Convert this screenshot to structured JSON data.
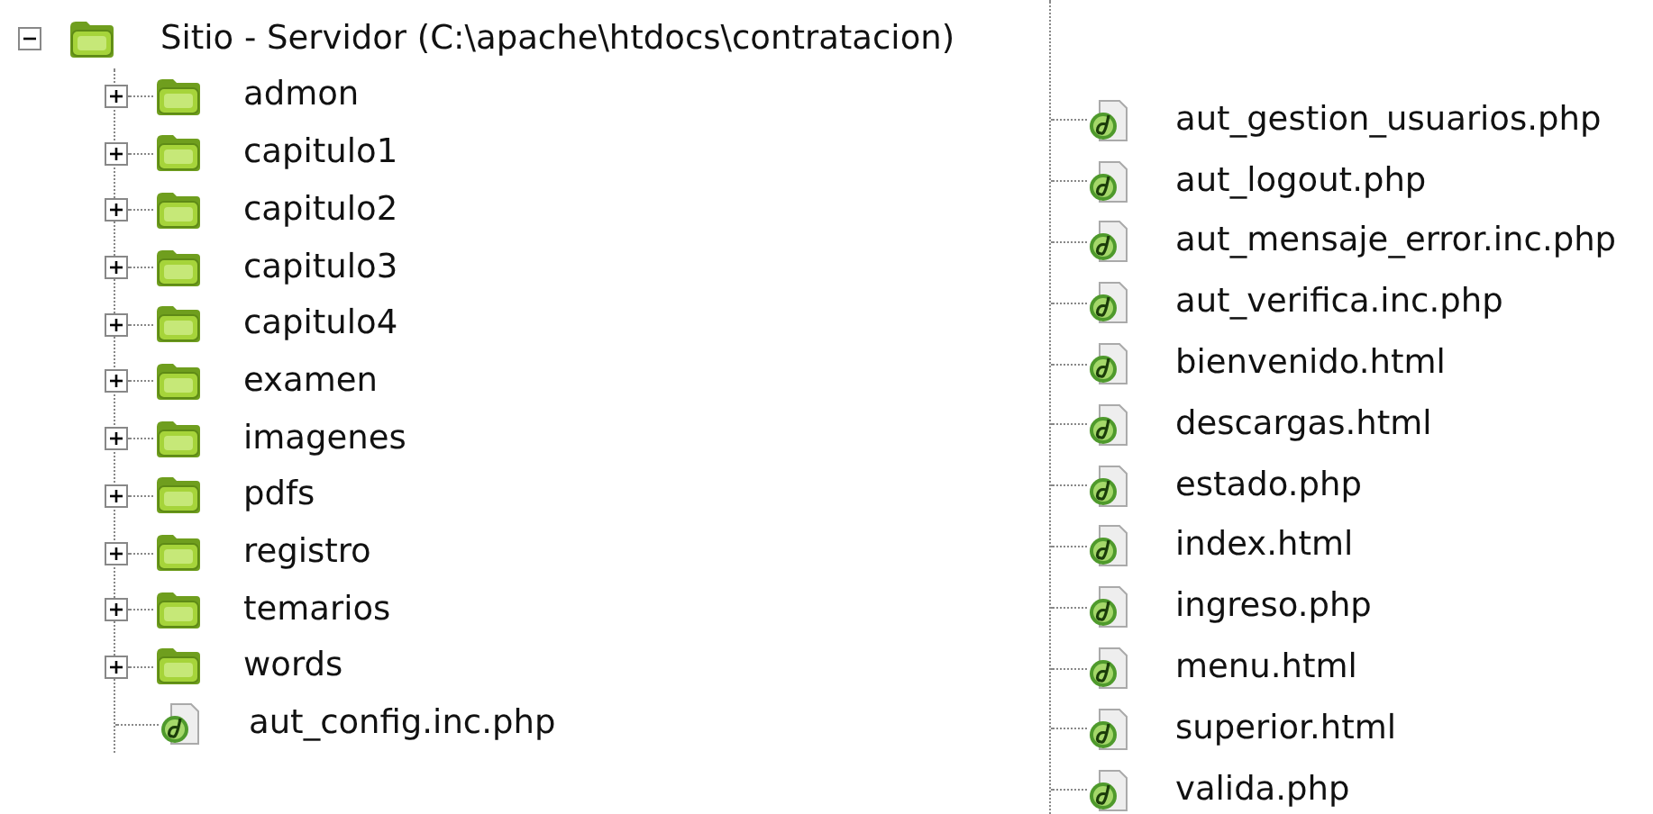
{
  "tree": {
    "label": "Sitio - Servidor (C:\\apache\\htdocs\\contratacion)",
    "expanded": true,
    "children": [
      {
        "kind": "folder",
        "label": "admon",
        "expanded": false
      },
      {
        "kind": "folder",
        "label": "capitulo1",
        "expanded": false
      },
      {
        "kind": "folder",
        "label": "capitulo2",
        "expanded": false
      },
      {
        "kind": "folder",
        "label": "capitulo3",
        "expanded": false
      },
      {
        "kind": "folder",
        "label": "capitulo4",
        "expanded": false
      },
      {
        "kind": "folder",
        "label": "examen",
        "expanded": false
      },
      {
        "kind": "folder",
        "label": "imagenes",
        "expanded": false
      },
      {
        "kind": "folder",
        "label": "pdfs",
        "expanded": false
      },
      {
        "kind": "folder",
        "label": "registro",
        "expanded": false
      },
      {
        "kind": "folder",
        "label": "temarios",
        "expanded": false
      },
      {
        "kind": "folder",
        "label": "words",
        "expanded": false
      },
      {
        "kind": "file",
        "label": "aut_config.inc.php"
      },
      {
        "kind": "file",
        "label": "aut_gestion_usuarios.php"
      },
      {
        "kind": "file",
        "label": "aut_logout.php"
      },
      {
        "kind": "file",
        "label": "aut_mensaje_error.inc.php"
      },
      {
        "kind": "file",
        "label": "aut_verifica.inc.php"
      },
      {
        "kind": "file",
        "label": "bienvenido.html"
      },
      {
        "kind": "file",
        "label": "descargas.html"
      },
      {
        "kind": "file",
        "label": "estado.php"
      },
      {
        "kind": "file",
        "label": "index.html"
      },
      {
        "kind": "file",
        "label": "ingreso.php"
      },
      {
        "kind": "file",
        "label": "menu.html"
      },
      {
        "kind": "file",
        "label": "superior.html"
      },
      {
        "kind": "file",
        "label": "valida.php"
      }
    ]
  }
}
